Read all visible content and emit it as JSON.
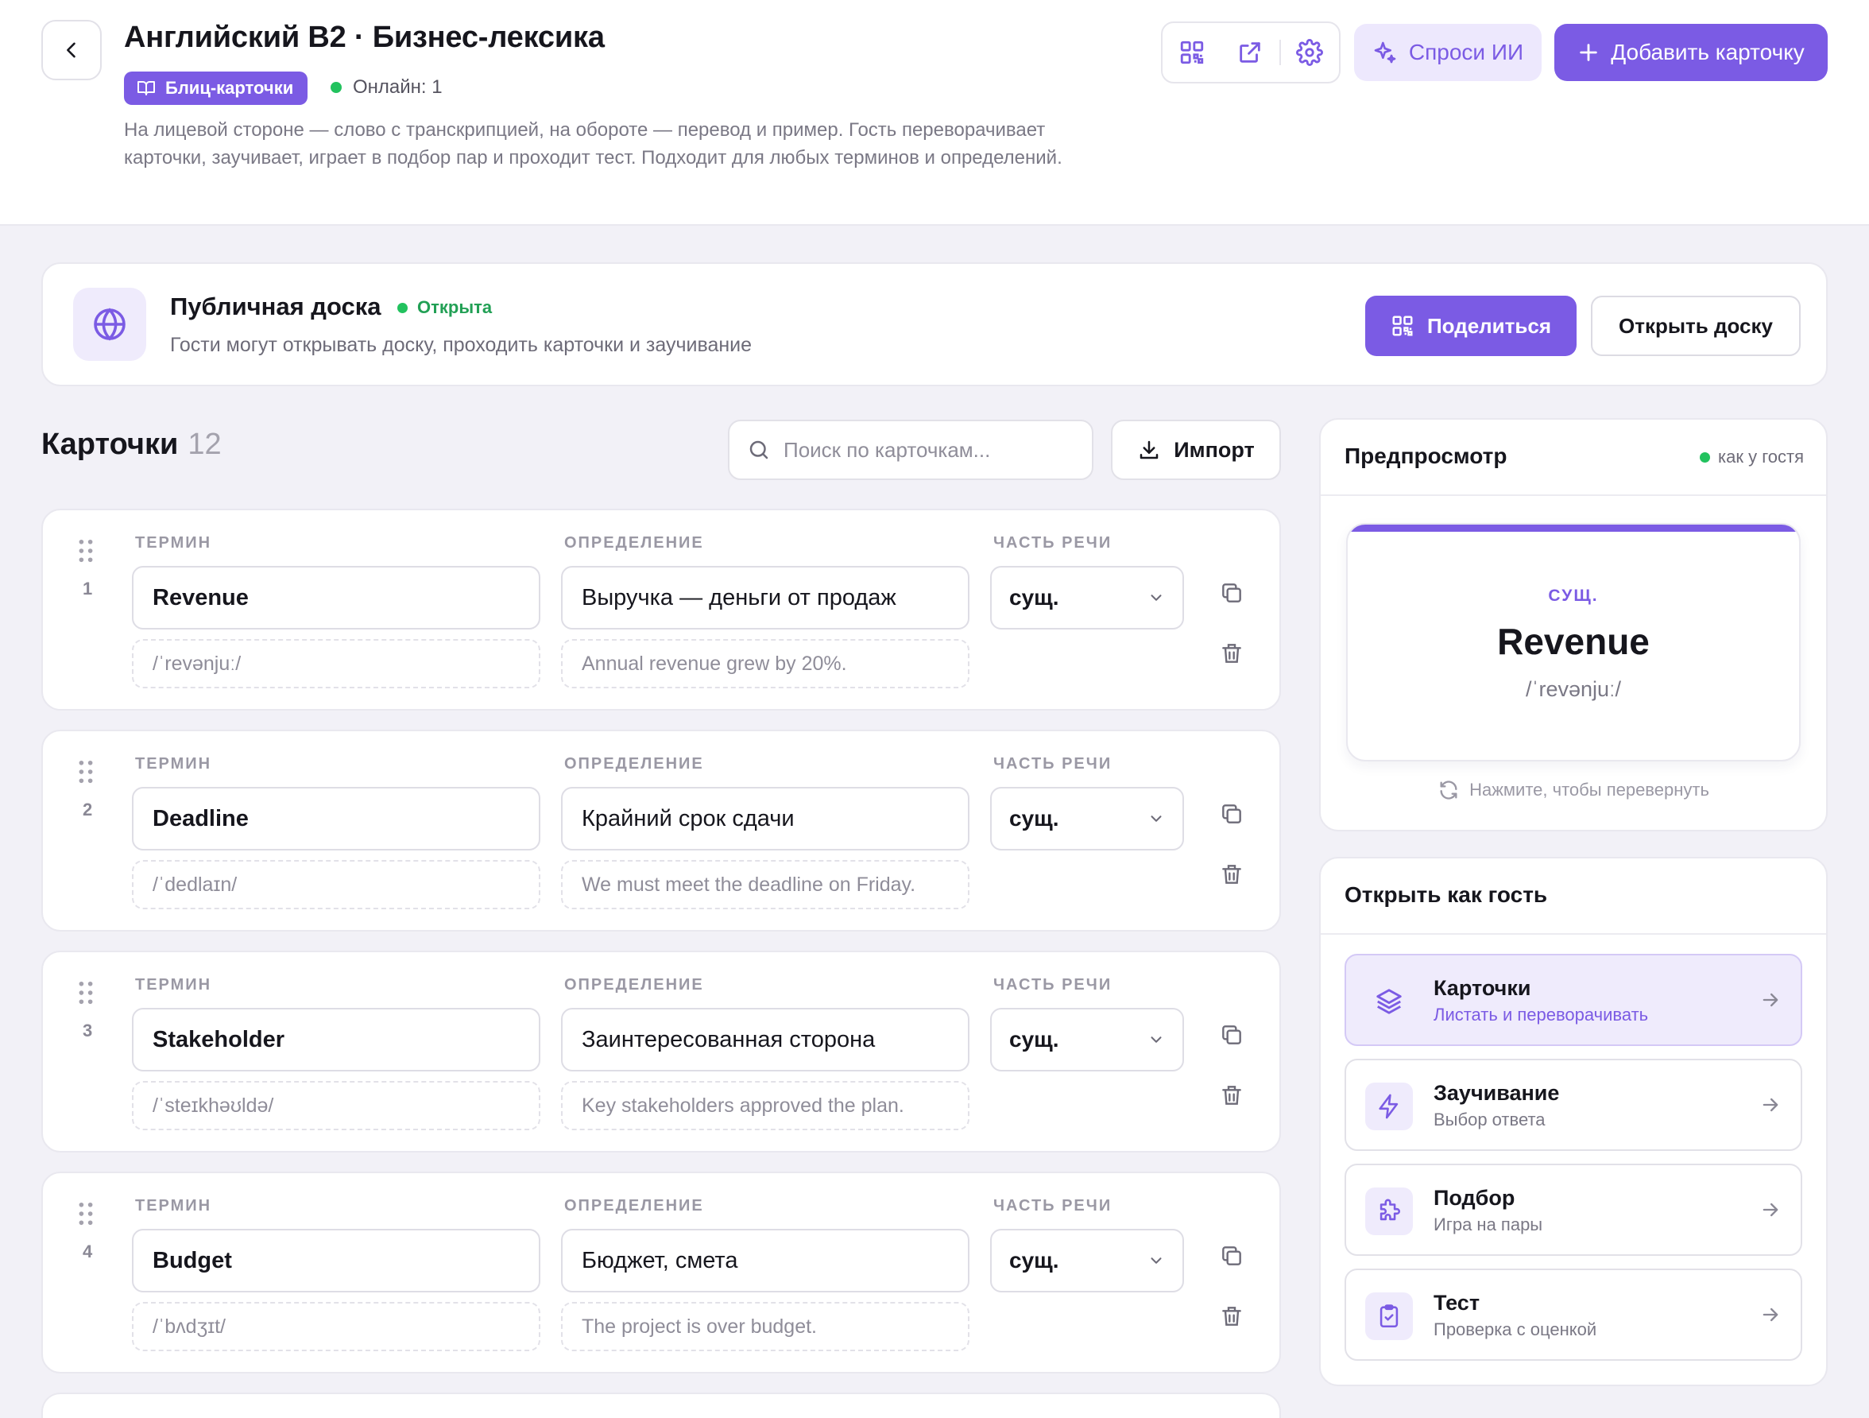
{
  "header": {
    "title": "Английский B2 · Бизнес-лексика",
    "type_badge": "Блиц-карточки",
    "online": "Онлайн: 1",
    "description": "На лицевой стороне — слово с транскрипцией, на обороте — перевод и пример. Гость переворачивает карточки, заучивает, играет в подбор пар и проходит тест. Подходит для любых терминов и определений.",
    "ai_label": "Спроси ИИ",
    "add_card_label": "Добавить карточку",
    "toolbar_icons": [
      "qr-code-icon",
      "external-link-icon",
      "gear-icon"
    ]
  },
  "public_board": {
    "title": "Публичная доска",
    "status": "Открыта",
    "subtitle": "Гости могут открывать доску, проходить карточки и заучивание",
    "share_label": "Поделиться",
    "open_label": "Открыть доску"
  },
  "cards_section": {
    "title": "Карточки",
    "count": "12",
    "search_placeholder": "Поиск по карточкам...",
    "import_label": "Импорт",
    "labels": {
      "term": "ТЕРМИН",
      "definition": "ОПРЕДЕЛЕНИЕ",
      "pos": "ЧАСТЬ РЕЧИ"
    }
  },
  "cards": [
    {
      "num": "1",
      "term": "Revenue",
      "transcription": "/ˈrevənjuː/",
      "definition": "Выручка — деньги от продаж",
      "example": "Annual revenue grew by 20%.",
      "pos": "сущ."
    },
    {
      "num": "2",
      "term": "Deadline",
      "transcription": "/ˈdedlaɪn/",
      "definition": "Крайний срок сдачи",
      "example": "We must meet the deadline on Friday.",
      "pos": "сущ."
    },
    {
      "num": "3",
      "term": "Stakeholder",
      "transcription": "/ˈsteɪkhəʊldə/",
      "definition": "Заинтересованная сторона",
      "example": "Key stakeholders approved the plan.",
      "pos": "сущ."
    },
    {
      "num": "4",
      "term": "Budget",
      "transcription": "/ˈbʌdʒɪt/",
      "definition": "Бюджет, смета",
      "example": "The project is over budget.",
      "pos": "сущ."
    }
  ],
  "preview": {
    "title": "Предпросмотр",
    "guest_label": "как у гостя",
    "pos": "СУЩ.",
    "word": "Revenue",
    "transcription": "/ˈrevənjuː/",
    "flip_hint": "Нажмите, чтобы перевернуть"
  },
  "guest_modes": {
    "title": "Открыть как гость",
    "modes": [
      {
        "title": "Карточки",
        "subtitle": "Листать и переворачивать",
        "icon": "layers-icon",
        "active": true
      },
      {
        "title": "Заучивание",
        "subtitle": "Выбор ответа",
        "icon": "lightning-icon"
      },
      {
        "title": "Подбор",
        "subtitle": "Игра на пары",
        "icon": "puzzle-icon"
      },
      {
        "title": "Тест",
        "subtitle": "Проверка с оценкой",
        "icon": "clipboard-check-icon"
      }
    ]
  },
  "colors": {
    "accent": "#7b5be4",
    "accent_soft": "#efebfc",
    "online": "#22c25e",
    "background": "#f2f1f7"
  }
}
